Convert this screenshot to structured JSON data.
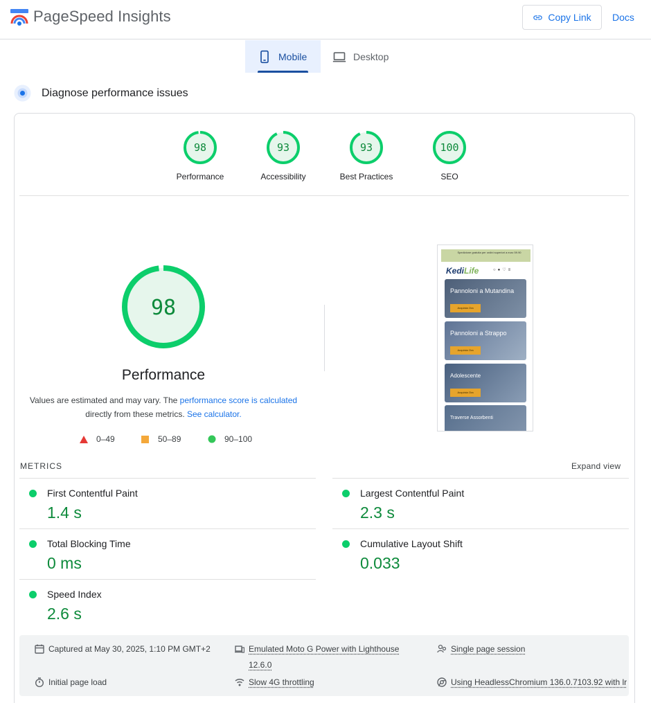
{
  "header": {
    "title": "PageSpeed Insights",
    "copy_link_label": "Copy Link",
    "docs_label": "Docs"
  },
  "tabs": [
    {
      "label": "Mobile",
      "active": true
    },
    {
      "label": "Desktop",
      "active": false
    }
  ],
  "section": {
    "title": "Diagnose performance issues"
  },
  "categories": [
    {
      "label": "Performance",
      "score": "98"
    },
    {
      "label": "Accessibility",
      "score": "93"
    },
    {
      "label": "Best Practices",
      "score": "93"
    },
    {
      "label": "SEO",
      "score": "100"
    }
  ],
  "performance": {
    "score": "98",
    "title": "Performance",
    "desc_part1": "Values are estimated and may vary. The ",
    "desc_link1": "performance score is calculated",
    "desc_part2": "directly from these metrics. ",
    "desc_link2": "See calculator."
  },
  "legend": [
    {
      "range": "0–49",
      "shape": "triangle",
      "color": "#e53935"
    },
    {
      "range": "50–89",
      "shape": "square",
      "color": "#f4a83a"
    },
    {
      "range": "90–100",
      "shape": "circle",
      "color": "#34c759"
    }
  ],
  "thumbnail": {
    "banner": "Spedizione gratuita per ordini superiori a euro 59.90",
    "logo_a": "Kedi",
    "logo_b": "Life",
    "cards": [
      {
        "title": "Pannoloni a Mutandina",
        "button": "Acquista Ora"
      },
      {
        "title": "Pannoloni a Strappo",
        "button": "Acquista Ora"
      },
      {
        "title": "Adolescente",
        "button": "Acquista Ora"
      },
      {
        "title": "Traverse Assorbenti",
        "button": ""
      }
    ]
  },
  "metrics": {
    "title": "METRICS",
    "expand_label": "Expand view",
    "items": [
      {
        "name": "First Contentful Paint",
        "value": "1.4 s"
      },
      {
        "name": "Largest Contentful Paint",
        "value": "2.3 s"
      },
      {
        "name": "Total Blocking Time",
        "value": "0 ms"
      },
      {
        "name": "Cumulative Layout Shift",
        "value": "0.033"
      },
      {
        "name": "Speed Index",
        "value": "2.6 s"
      }
    ]
  },
  "footer": {
    "captured": "Captured at May 30, 2025, 1:10 PM GMT+2",
    "device_line1": "Emulated Moto G Power with Lighthouse",
    "device_line2": "12.6.0",
    "session": "Single page session",
    "load": "Initial page load",
    "throttling": "Slow 4G throttling",
    "browser": "Using HeadlessChromium 136.0.7103.92 with lr"
  },
  "colors": {
    "accent": "#1a73e8",
    "good": "#0cce6b",
    "good_text": "#0d8a3b"
  }
}
